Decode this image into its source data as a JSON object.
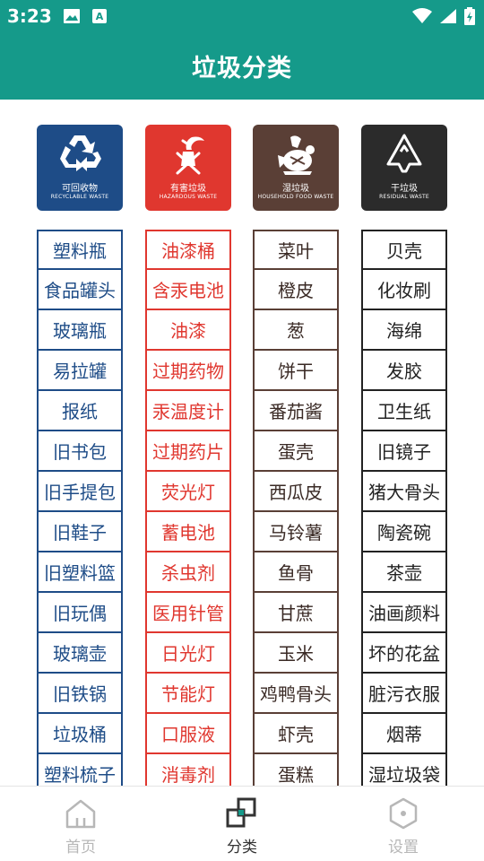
{
  "status_bar": {
    "time": "3:23",
    "left_icons": [
      "image-icon",
      "a11y-notification-icon"
    ],
    "right_icons": [
      "wifi-icon",
      "signal-icon",
      "battery-icon"
    ]
  },
  "app_bar": {
    "title": "垃圾分类"
  },
  "colors": {
    "primary": "#159a8a",
    "recyclable": "#1e4c87",
    "hazardous": "#e0372f",
    "household_food": "#5a3f36",
    "residual": "#2b2b2b"
  },
  "categories": [
    {
      "key": "recyc",
      "cn": "可回收物",
      "en": "RECYCLABLE WASTE",
      "icon": "recycle-icon",
      "items": [
        "塑料瓶",
        "食品罐头",
        "玻璃瓶",
        "易拉罐",
        "报纸",
        "旧书包",
        "旧手提包",
        "旧鞋子",
        "旧塑料篮",
        "旧玩偶",
        "玻璃壶",
        "旧铁锅",
        "垃圾桶",
        "塑料梳子"
      ]
    },
    {
      "key": "haz",
      "cn": "有害垃圾",
      "en": "HAZARDOUS WASTE",
      "icon": "hazardous-icon",
      "items": [
        "油漆桶",
        "含汞电池",
        "油漆",
        "过期药物",
        "汞温度计",
        "过期药片",
        "荧光灯",
        "蓄电池",
        "杀虫剂",
        "医用针管",
        "日光灯",
        "节能灯",
        "口服液",
        "消毒剂"
      ]
    },
    {
      "key": "wet",
      "cn": "湿垃圾",
      "en": "HOUSEHOLD FOOD WASTE",
      "icon": "food-waste-icon",
      "items": [
        "菜叶",
        "橙皮",
        "葱",
        "饼干",
        "番茄酱",
        "蛋壳",
        "西瓜皮",
        "马铃薯",
        "鱼骨",
        "甘蔗",
        "玉米",
        "鸡鸭骨头",
        "虾壳",
        "蛋糕"
      ]
    },
    {
      "key": "dry",
      "cn": "干垃圾",
      "en": "RESIDUAL WASTE",
      "icon": "residual-icon",
      "items": [
        "贝壳",
        "化妆刷",
        "海绵",
        "发胶",
        "卫生纸",
        "旧镜子",
        "猪大骨头",
        "陶瓷碗",
        "茶壶",
        "油画颜料",
        "坏的花盆",
        "脏污衣服",
        "烟蒂",
        "湿垃圾袋"
      ]
    }
  ],
  "bottom_nav": {
    "items": [
      {
        "label": "首页",
        "icon": "home-icon",
        "active": false
      },
      {
        "label": "分类",
        "icon": "category-icon",
        "active": true
      },
      {
        "label": "设置",
        "icon": "settings-icon",
        "active": false
      }
    ]
  }
}
